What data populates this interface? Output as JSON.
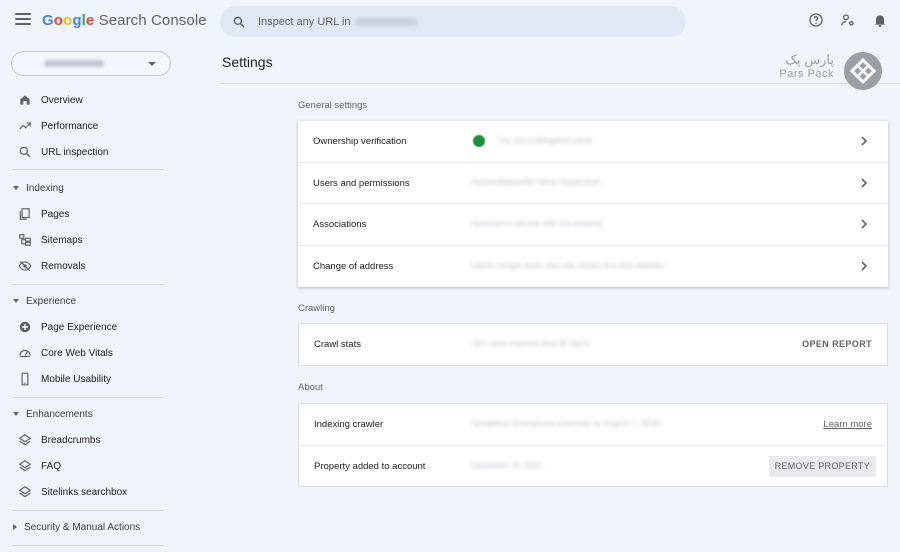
{
  "header": {
    "app_title_google": "Google",
    "app_title_rest": " Search Console",
    "search_placeholder": "Inspect any URL in"
  },
  "sidebar": {
    "top_items": [
      {
        "label": "Overview",
        "icon": "home-icon"
      },
      {
        "label": "Performance",
        "icon": "trending-up-icon"
      },
      {
        "label": "URL inspection",
        "icon": "search-icon"
      }
    ],
    "sections": [
      {
        "label": "Indexing",
        "items": [
          {
            "label": "Pages",
            "icon": "pages-icon"
          },
          {
            "label": "Sitemaps",
            "icon": "sitemap-icon"
          },
          {
            "label": "Removals",
            "icon": "eye-off-icon"
          }
        ]
      },
      {
        "label": "Experience",
        "items": [
          {
            "label": "Page Experience",
            "icon": "plus-circle-icon"
          },
          {
            "label": "Core Web Vitals",
            "icon": "gauge-icon"
          },
          {
            "label": "Mobile Usability",
            "icon": "phone-icon"
          }
        ]
      },
      {
        "label": "Enhancements",
        "items": [
          {
            "label": "Breadcrumbs",
            "icon": "layers-icon"
          },
          {
            "label": "FAQ",
            "icon": "layers-icon"
          },
          {
            "label": "Sitelinks searchbox",
            "icon": "layers-icon"
          }
        ]
      }
    ],
    "security_label": "Security & Manual Actions"
  },
  "main": {
    "title": "Settings",
    "general": {
      "label": "General settings",
      "rows": [
        {
          "label": "Ownership verification",
          "value": "You are a delegated owner"
        },
        {
          "label": "Users and permissions",
          "value": "HosseinBabaei90, Reza Sepahvand"
        },
        {
          "label": "Associations",
          "value": "Associate a service with this property"
        },
        {
          "label": "Change of address",
          "value": "Inform Google when your site moves to a new address"
        }
      ]
    },
    "crawling": {
      "label": "Crawling",
      "row": {
        "label": "Crawl stats",
        "value": "313 crawl requests (last 90 days)",
        "action": "OPEN REPORT"
      }
    },
    "about": {
      "label": "About",
      "rows": [
        {
          "label": "Indexing crawler",
          "value": "Googlebot Smartphone (switched on August 7, 2018)",
          "action": "Learn more"
        },
        {
          "label": "Property added to account",
          "value": "December 24, 2022",
          "action": "REMOVE PROPERTY"
        }
      ]
    }
  },
  "watermark": {
    "fa": "پارس پک",
    "en": "Pars Pack"
  },
  "colors": {
    "background": "#f0f4fb",
    "search_bg": "#e1e8f5",
    "verified_green": "#1e8e3e"
  }
}
